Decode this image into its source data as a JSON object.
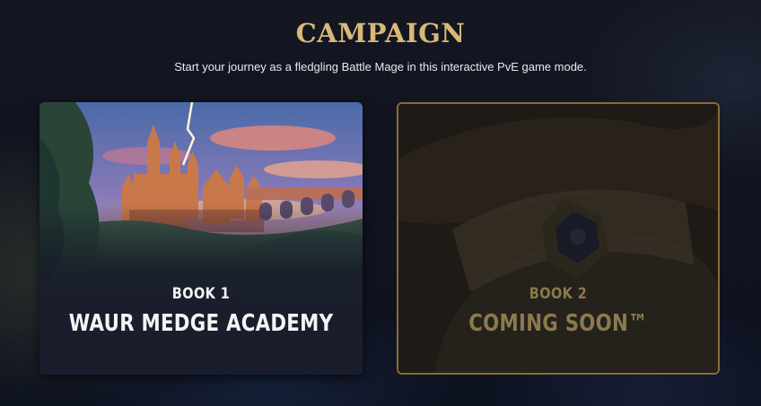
{
  "header": {
    "title": "CAMPAIGN",
    "subtitle": "Start your journey as a fledgling Battle Mage in this interactive PvE game mode."
  },
  "cards": [
    {
      "book_label": "BOOK 1",
      "title": "WAUR MEDGE ACADEMY",
      "available": true,
      "image": "castle-academy-art"
    },
    {
      "book_label": "BOOK 2",
      "title": "COMING SOON™",
      "available": false,
      "image": "sealed-book-art"
    }
  ],
  "colors": {
    "accent_gold": "#d9b878",
    "locked_text": "#8a7a4e",
    "locked_border": "#8a6b3a",
    "background": "#10131d"
  }
}
